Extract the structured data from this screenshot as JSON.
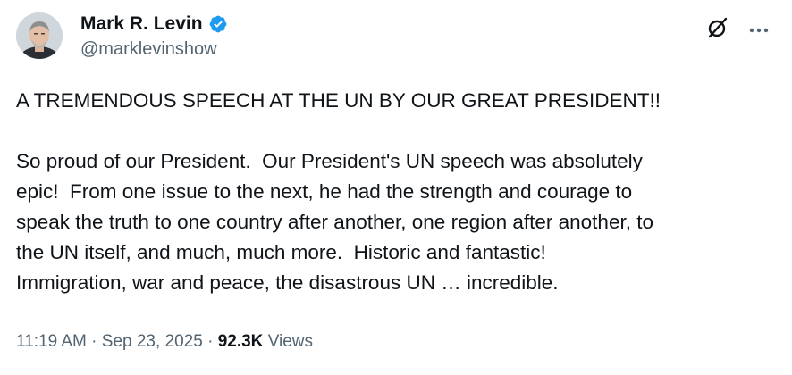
{
  "author": {
    "display_name": "Mark R. Levin",
    "handle": "@marklevinshow",
    "verified": true
  },
  "icons": {
    "verified": "verified-badge-icon",
    "grok": "grok-icon",
    "more": "more-options-icon"
  },
  "colors": {
    "verified_badge": "#1d9bf0",
    "text_primary": "#0f1419",
    "text_secondary": "#536471"
  },
  "post": {
    "headline": "A TREMENDOUS SPEECH AT THE UN BY OUR GREAT PRESIDENT!!",
    "lines": [
      "So proud of our President.  Our President's UN speech was absolutely",
      "epic!  From one issue to the next, he had the strength and courage to",
      "speak the truth to one country after another, one region after another, to",
      "the UN itself, and much, much more.  Historic and fantastic!",
      "Immigration, war and peace, the disastrous UN … incredible."
    ]
  },
  "meta": {
    "time": "11:19 AM",
    "date": "Sep 23, 2025",
    "separator": "·",
    "views_count": "92.3K",
    "views_label": "Views"
  }
}
